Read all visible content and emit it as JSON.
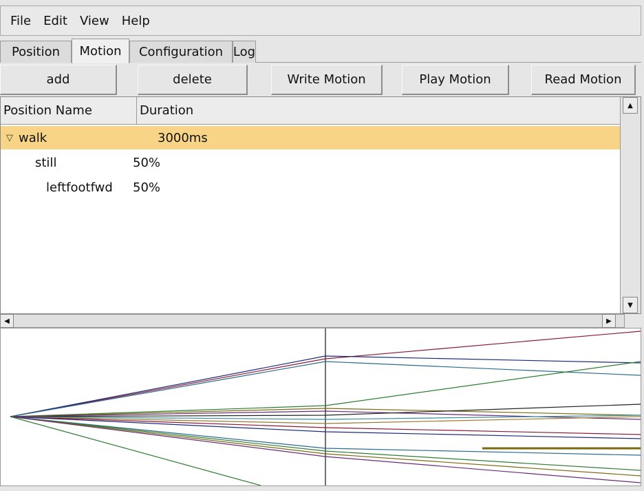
{
  "menu": [
    "File",
    "Edit",
    "View",
    "Help"
  ],
  "tabs": [
    {
      "label": "Position",
      "active": false
    },
    {
      "label": "Motion",
      "active": true
    },
    {
      "label": "Configuration",
      "active": false
    },
    {
      "label": "Log",
      "active": false
    }
  ],
  "toolbar": {
    "add_label": "add",
    "delete_label": "delete",
    "write_label": "Write Motion",
    "play_label": "Play Motion",
    "read_label": "Read Motion"
  },
  "table": {
    "columns": [
      "Position Name",
      "Duration"
    ],
    "rows": [
      {
        "name": "walk",
        "duration": "3000ms",
        "expanded": true,
        "selected": true
      },
      {
        "name": "still",
        "duration": "50%"
      },
      {
        "name": "leftfootfwd",
        "duration": "50%"
      }
    ]
  },
  "graph": {
    "colors": [
      "#8b1a3a",
      "#1b2a7a",
      "#2a6a8a",
      "#2e7d32",
      "#7a6a10",
      "#6a2a7a",
      "#222222",
      "#3a8a9a",
      "#9a7a30"
    ]
  }
}
